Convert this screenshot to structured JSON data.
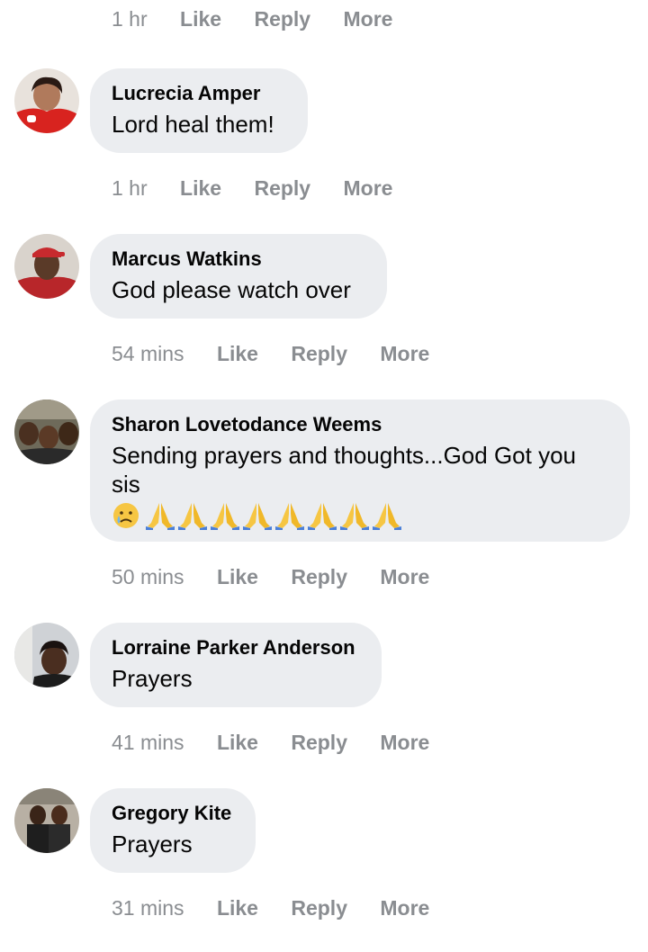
{
  "top_actions": {
    "time": "1 hr",
    "like": "Like",
    "reply": "Reply",
    "more": "More"
  },
  "comments": [
    {
      "author": "Lucrecia Amper",
      "text": "Lord heal them!",
      "time": "1 hr",
      "like": "Like",
      "reply": "Reply",
      "more": "More"
    },
    {
      "author": "Marcus Watkins",
      "text": "God please watch over",
      "time": "54 mins",
      "like": "Like",
      "reply": "Reply",
      "more": "More"
    },
    {
      "author": "Sharon Lovetodance Weems",
      "text": "Sending prayers and thoughts...God Got you sis",
      "emojis": [
        "crying-face",
        "folded-hands",
        "folded-hands",
        "folded-hands",
        "folded-hands",
        "folded-hands",
        "folded-hands",
        "folded-hands",
        "folded-hands"
      ],
      "time": "50 mins",
      "like": "Like",
      "reply": "Reply",
      "more": "More"
    },
    {
      "author": "Lorraine Parker Anderson",
      "text": "Prayers",
      "time": "41 mins",
      "like": "Like",
      "reply": "Reply",
      "more": "More"
    },
    {
      "author": "Gregory Kite",
      "text": "Prayers",
      "time": "31 mins",
      "like": "Like",
      "reply": "Reply",
      "more": "More"
    }
  ],
  "colors": {
    "bubble": "#ebedf0",
    "meta": "#8a8d91",
    "text": "#050505"
  }
}
